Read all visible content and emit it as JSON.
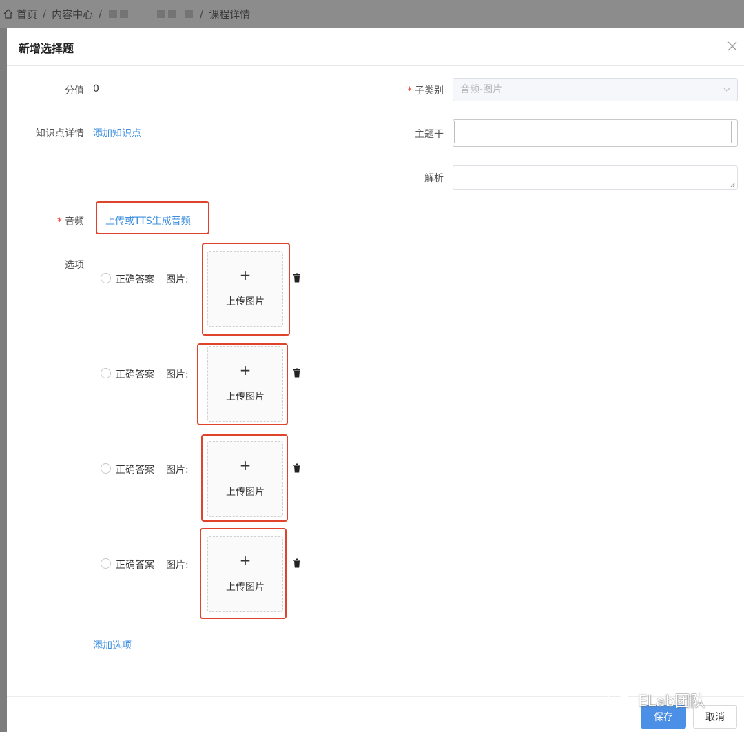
{
  "breadcrumb": {
    "home": "首页",
    "content_center": "内容中心",
    "current": "课程详情"
  },
  "dialog": {
    "title": "新增选择题"
  },
  "form": {
    "score_label": "分值",
    "score_value": "0",
    "knowledge_label": "知识点详情",
    "knowledge_link": "添加知识点",
    "subcategory_label": "子类别",
    "subcategory_value": "音频-图片",
    "stem_label": "主题干",
    "analysis_label": "解析",
    "audio_label": "音频",
    "audio_link": "上传或TTS生成音频",
    "options_label": "选项",
    "add_option_link": "添加选项"
  },
  "options": [
    {
      "correct_label": "正确答案",
      "image_label": "图片:",
      "upload_plus": "+",
      "upload_text": "上传图片"
    },
    {
      "correct_label": "正确答案",
      "image_label": "图片:",
      "upload_plus": "+",
      "upload_text": "上传图片"
    },
    {
      "correct_label": "正确答案",
      "image_label": "图片:",
      "upload_plus": "+",
      "upload_text": "上传图片"
    },
    {
      "correct_label": "正确答案",
      "image_label": "图片:",
      "upload_plus": "+",
      "upload_text": "上传图片"
    }
  ],
  "footer": {
    "save": "保存",
    "cancel": "取消"
  },
  "watermark": "ELab团队",
  "colors": {
    "accent": "#4b8fe6",
    "link": "#3b8ee0",
    "required": "#f04134",
    "highlight": "#e0432c"
  }
}
